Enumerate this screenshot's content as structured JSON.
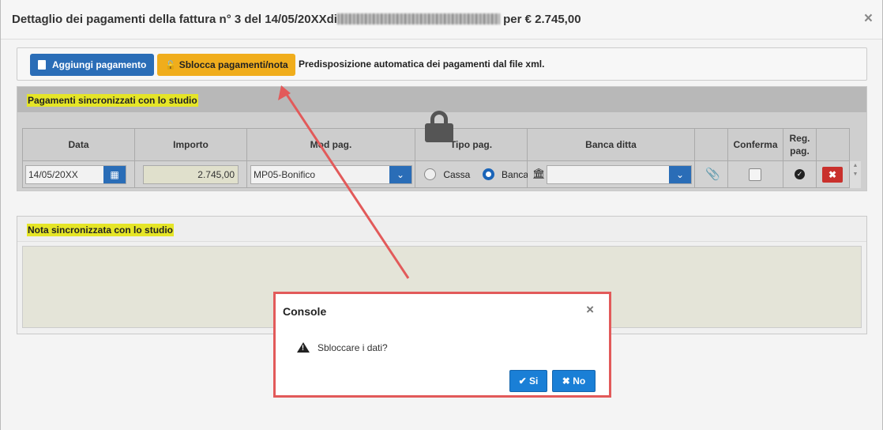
{
  "modal": {
    "title_prefix": "Dettaglio dei pagamenti della fattura n° 3 del 14/05/20XXdi",
    "title_suffix": "per € 2.745,00",
    "close_label": "×"
  },
  "toolbar": {
    "add_payment": "Aggiungi pagamento",
    "unlock_payments": "Sblocca pagamenti/nota",
    "auto_text": "Predisposizione automatica dei pagamenti dal file xml."
  },
  "payments_panel": {
    "title": "Pagamenti sincronizzati con lo studio",
    "columns": [
      "Data",
      "Importo",
      "Mod pag.",
      "Tipo pag.",
      "Banca ditta",
      "",
      "Conferma",
      "Reg. pag.",
      ""
    ],
    "row": {
      "date": "14/05/20XX",
      "amount": "2.745,00",
      "payment_mode": "MP05-Bonifico",
      "type_cash": "Cassa",
      "type_bank": "Banca",
      "selected_type": "Banca",
      "bank": "",
      "confirmed": false
    }
  },
  "note_panel": {
    "title": "Nota sincronizzata con lo studio",
    "value": ""
  },
  "dialog": {
    "title": "Console",
    "message": "Sbloccare i dati?",
    "yes_label": "Si",
    "no_label": "No",
    "close_label": "×"
  },
  "colors": {
    "primary": "#2a6db7",
    "warning": "#f0ad1c",
    "danger": "#c9302c",
    "highlight": "#e5e527",
    "annotation": "#e25a5a"
  }
}
